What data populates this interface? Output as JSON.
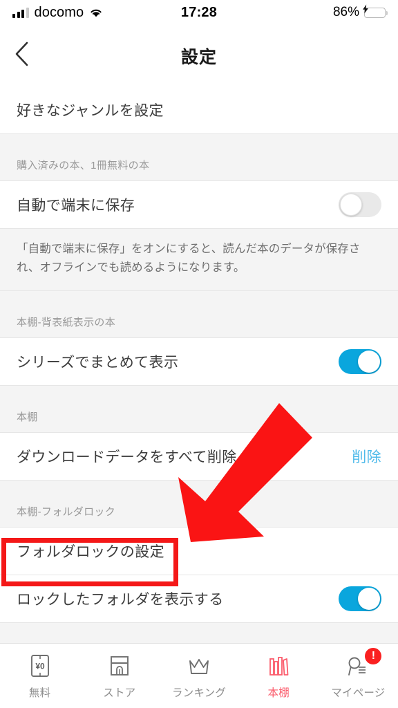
{
  "statusbar": {
    "carrier": "docomo",
    "time": "17:28",
    "battery_percent": "86%",
    "signal_icon": "signal-bars-icon",
    "wifi_icon": "wifi-icon",
    "battery_icon": "battery-charging-icon"
  },
  "header": {
    "title": "設定",
    "back_icon": "back-chevron-icon"
  },
  "list": [
    {
      "kind": "row",
      "label": "好きなジャンルを設定"
    },
    {
      "kind": "section",
      "label": "購入済みの本、1冊無料の本"
    },
    {
      "kind": "toggle",
      "label": "自動で端末に保存",
      "state": "off"
    },
    {
      "kind": "note",
      "label": "「自動で端末に保存」をオンにすると、読んだ本のデータが保存され、オフラインでも読めるようになります。"
    },
    {
      "kind": "section",
      "label": "本棚-背表紙表示の本"
    },
    {
      "kind": "toggle",
      "label": "シリーズでまとめて表示",
      "state": "on"
    },
    {
      "kind": "section",
      "label": "本棚"
    },
    {
      "kind": "action",
      "label": "ダウンロードデータをすべて削除",
      "action": "削除"
    },
    {
      "kind": "section",
      "label": "本棚-フォルダロック"
    },
    {
      "kind": "row",
      "label": "フォルダロックの設定"
    },
    {
      "kind": "toggle",
      "label": "ロックしたフォルダを表示する",
      "state": "on"
    }
  ],
  "rows": {
    "genre": "好きなジャンルを設定",
    "section_purchased": "購入済みの本、1冊無料の本",
    "auto_save": "自動で端末に保存",
    "auto_save_note": "「自動で端末に保存」をオンにすると、読んだ本のデータが保存され、オフラインでも読めるようになります。",
    "section_spine": "本棚-背表紙表示の本",
    "series_group": "シリーズでまとめて表示",
    "section_shelf": "本棚",
    "delete_downloads": "ダウンロードデータをすべて削除",
    "delete_action": "削除",
    "section_folderlock": "本棚-フォルダロック",
    "folderlock_setting": "フォルダロックの設定",
    "show_locked_folder": "ロックしたフォルダを表示する"
  },
  "tabbar": {
    "items": [
      {
        "label": "無料",
        "icon": "free-yen-book-icon",
        "active": false
      },
      {
        "label": "ストア",
        "icon": "store-icon",
        "active": false
      },
      {
        "label": "ランキング",
        "icon": "crown-icon",
        "active": false
      },
      {
        "label": "本棚",
        "icon": "bookshelf-icon",
        "active": true
      },
      {
        "label": "マイページ",
        "icon": "my-page-person-icon",
        "active": false,
        "badge": "!"
      }
    ]
  },
  "annotations": {
    "highlight_target": "フォルダロックの設定",
    "arrow_icon": "red-pointer-arrow",
    "highlight_color": "#f41818",
    "arrow_color": "#fa1414"
  },
  "colors": {
    "toggle_on": "#0aa6dd",
    "toggle_off": "#e9e9e9",
    "link": "#4fbaea",
    "active_tab": "#fb5c6c",
    "section_bg": "#f4f4f4"
  }
}
